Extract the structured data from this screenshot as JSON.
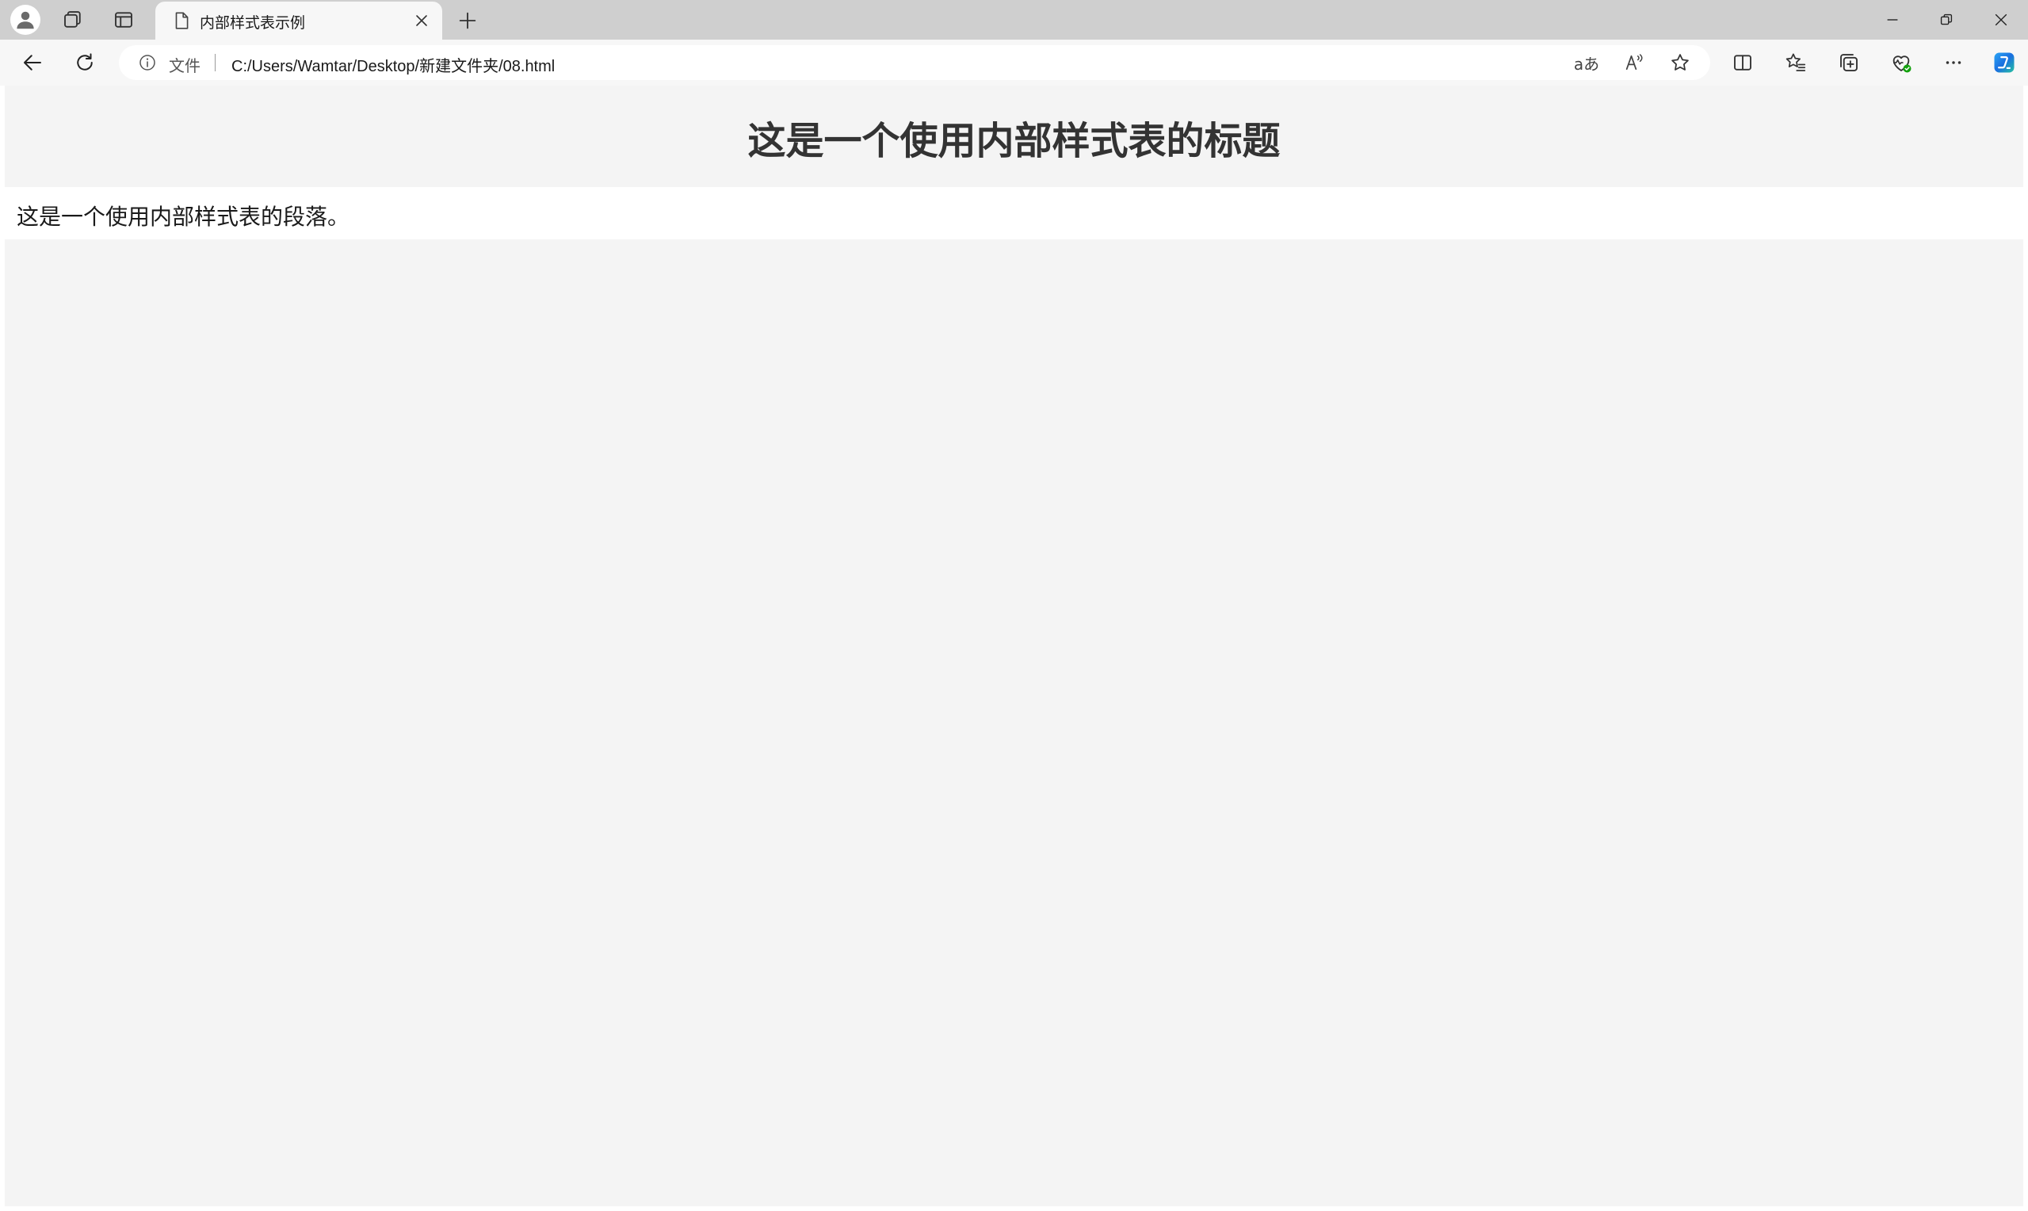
{
  "browser": {
    "tab": {
      "title": "内部样式表示例",
      "icon": "page-icon"
    },
    "address_bar": {
      "scheme_label": "文件",
      "url": "C:/Users/Wamtar/Desktop/新建文件夹/08.html"
    },
    "toolbar_icons": [
      "back-icon",
      "refresh-icon",
      "translate-icon",
      "read-aloud-icon",
      "favorite-star-icon",
      "split-screen-icon",
      "favorites-icon",
      "collections-icon",
      "browser-essentials-icon",
      "more-icon",
      "copilot-icon"
    ],
    "window_controls": [
      "minimize-icon",
      "restore-icon",
      "close-icon"
    ],
    "translate_glyph": "aあ",
    "read_aloud_glyph": "A",
    "more_glyph": "···"
  },
  "page": {
    "heading": "这是一个使用内部样式表的标题",
    "paragraph": "这是一个使用内部样式表的段落。"
  },
  "colors": {
    "tabstrip_bg": "#cfcfcf",
    "toolbar_bg": "#f7f7f7",
    "page_bg": "#f4f4f4",
    "paragraph_bg": "#ffffff",
    "heading_color": "#333333"
  }
}
